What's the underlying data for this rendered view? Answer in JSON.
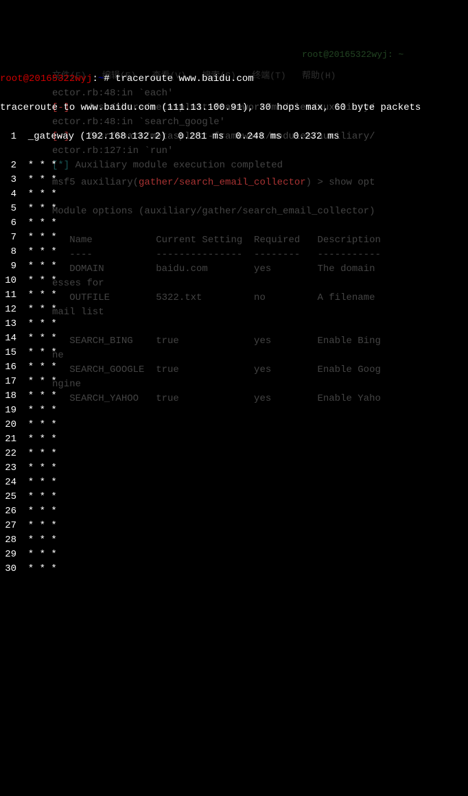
{
  "prompt": {
    "user": "root",
    "host": "20165322wyj",
    "path": "~",
    "symbol": "#",
    "command": "traceroute www.baidu.com"
  },
  "trace_header": "traceroute to www.baidu.com (111.13.100.91), 30 hops max, 60 byte packets",
  "gateway_line": {
    "num": " 1",
    "text": "  _gateway (192.168.132.2)  0.281 ms  0.248 ms  0.232 ms"
  },
  "hops": [
    {
      "n": " 2",
      "t": "  * * *"
    },
    {
      "n": " 3",
      "t": "  * * *"
    },
    {
      "n": " 4",
      "t": "  * * *"
    },
    {
      "n": " 5",
      "t": "  * * *"
    },
    {
      "n": " 6",
      "t": "  * * *"
    },
    {
      "n": " 7",
      "t": "  * * *"
    },
    {
      "n": " 8",
      "t": "  * * *"
    },
    {
      "n": " 9",
      "t": "  * * *"
    },
    {
      "n": "10",
      "t": "  * * *"
    },
    {
      "n": "11",
      "t": "  * * *"
    },
    {
      "n": "12",
      "t": "  * * *"
    },
    {
      "n": "13",
      "t": "  * * *"
    },
    {
      "n": "14",
      "t": "  * * *"
    },
    {
      "n": "15",
      "t": "  * * *"
    },
    {
      "n": "16",
      "t": "  * * *"
    },
    {
      "n": "17",
      "t": "  * * *"
    },
    {
      "n": "18",
      "t": "  * * *"
    },
    {
      "n": "19",
      "t": "  * * *"
    },
    {
      "n": "20",
      "t": "  * * *"
    },
    {
      "n": "21",
      "t": "  * * *"
    },
    {
      "n": "22",
      "t": "  * * *"
    },
    {
      "n": "23",
      "t": "  * * *"
    },
    {
      "n": "24",
      "t": "  * * *"
    },
    {
      "n": "25",
      "t": "  * * *"
    },
    {
      "n": "26",
      "t": "  * * *"
    },
    {
      "n": "27",
      "t": "  * * *"
    },
    {
      "n": "28",
      "t": "  * * *"
    },
    {
      "n": "29",
      "t": "  * * *"
    },
    {
      "n": "30",
      "t": "  * * *"
    }
  ],
  "bg": {
    "title": "root@20165322wyj: ~",
    "menu": "文件(F)   编辑(E)   查看(V)   搜索(S)   终端(T)   帮助(H)",
    "l6": "ector.rb:48:in `each'",
    "l7a": "[-]",
    "l7b": "   /usr/share/metasploit-framework/modules/auxiliary/",
    "l8": "ector.rb:48:in `search_google'",
    "l9a": "[-]",
    "l9b": "   /usr/share/metasploit-framework/modules/auxiliary/",
    "l10": "ector.rb:127:in `run'",
    "l11a": "[*]",
    "l11b": " Auxiliary module execution completed",
    "l13a": "msf5",
    "l13b": " auxiliary(",
    "l13c": "gather/search_email_collector",
    "l13d": ") > show opt",
    "l15": "Module options (auxiliary/gather/search_email_collector)",
    "l17": "   Name           Current Setting  Required   Description",
    "l19": "   ----           ---------------  --------   -----------",
    "l20": "   DOMAIN         baidu.com        yes        The domain ",
    "l21": "esses for",
    "l22": "   OUTFILE        5322.txt         no         A filename ",
    "l23": "mail list",
    "l25": "   SEARCH_BING    true             yes        Enable Bing",
    "l26": "ne",
    "l27": "   SEARCH_GOOGLE  true             yes        Enable Goog",
    "l28": "ngine",
    "l30": "   SEARCH_YAHOO   true             yes        Enable Yaho"
  }
}
